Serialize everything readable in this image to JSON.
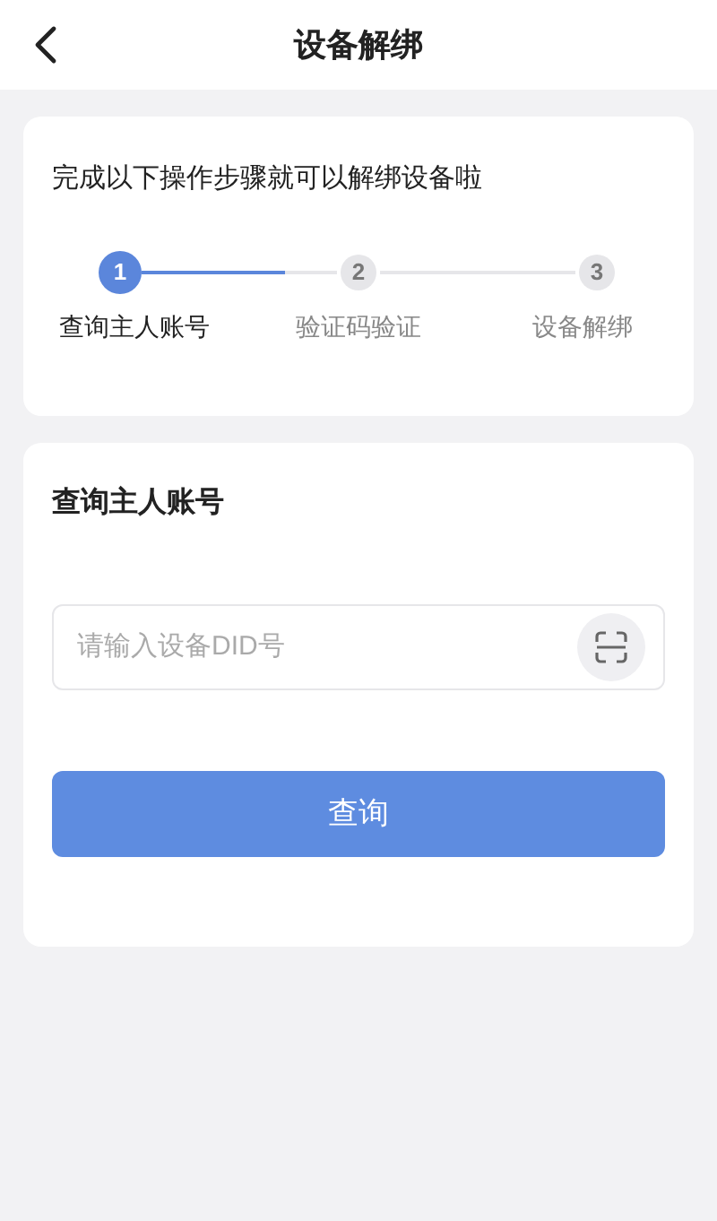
{
  "header": {
    "title": "设备解绑"
  },
  "steps_card": {
    "intro": "完成以下操作步骤就可以解绑设备啦",
    "level": 0.73,
    "steps": [
      {
        "number": "1",
        "label": "查询主人账号",
        "selected": true
      },
      {
        "number": "2",
        "label": "验证码验证",
        "selected": false
      },
      {
        "number": "3",
        "label": "设备解绑",
        "selected": false
      }
    ]
  },
  "form_card": {
    "title": "查询主人账号",
    "placeholder": "请输入设备DID号",
    "button": "查询"
  }
}
